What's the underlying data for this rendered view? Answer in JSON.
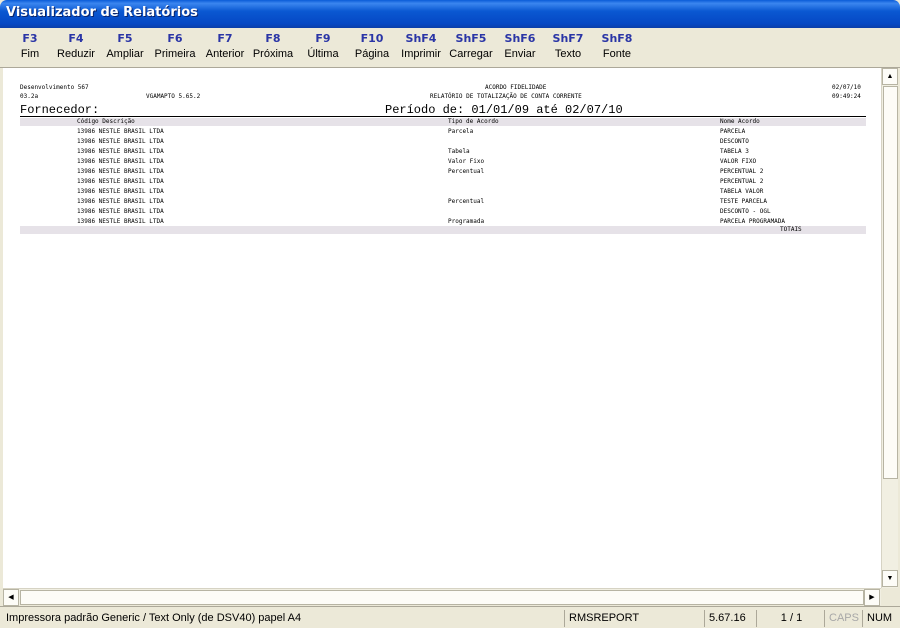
{
  "window": {
    "title": "Visualizador de Relatórios"
  },
  "toolbar": {
    "buttons": [
      {
        "key": "F3",
        "label": "Fim"
      },
      {
        "key": "F4",
        "label": "Reduzir"
      },
      {
        "key": "F5",
        "label": "Ampliar"
      },
      {
        "key": "F6",
        "label": "Primeira"
      },
      {
        "key": "F7",
        "label": "Anterior"
      },
      {
        "key": "F8",
        "label": "Próxima"
      },
      {
        "key": "F9",
        "label": "Última"
      },
      {
        "key": "F10",
        "label": "Página"
      },
      {
        "key": "ShF4",
        "label": "Imprimir"
      },
      {
        "key": "ShF5",
        "label": "Carregar"
      },
      {
        "key": "ShF6",
        "label": "Enviar"
      },
      {
        "key": "ShF7",
        "label": "Texto"
      },
      {
        "key": "ShF8",
        "label": "Fonte"
      }
    ]
  },
  "report": {
    "dept": "Desenvolvimento 567",
    "version": "03.2a",
    "program": "VGAMAPTO 5.65.2",
    "title": "ACORDO FIDELIDADE",
    "subtitle": "RELATÓRIO DE TOTALIZAÇÃO DE CONTA CORRENTE",
    "date": "02/07/10",
    "time": "09:49:24",
    "supplier_label": "Fornecedor:",
    "period": "Período de:  01/01/09  até  02/07/10",
    "col_code_desc": "Código Descrição",
    "col_type": "Tipo de Acordo",
    "col_name": "Nome Acordo",
    "rows": [
      {
        "code": "13986 NESTLE BRASIL LTDA",
        "type": "Parcela",
        "name": "PARCELA"
      },
      {
        "code": "13986 NESTLE BRASIL LTDA",
        "type": "",
        "name": "DESCONTO"
      },
      {
        "code": "13986 NESTLE BRASIL LTDA",
        "type": "Tabela",
        "name": "TABELA 3"
      },
      {
        "code": "13986 NESTLE BRASIL LTDA",
        "type": "Valor Fixo",
        "name": "VALOR FIXO"
      },
      {
        "code": "13986 NESTLE BRASIL LTDA",
        "type": "Percentual",
        "name": "PERCENTUAL 2"
      },
      {
        "code": "13986 NESTLE BRASIL LTDA",
        "type": "",
        "name": "PERCENTUAL 2"
      },
      {
        "code": "13986 NESTLE BRASIL LTDA",
        "type": "",
        "name": "TABELA VALOR"
      },
      {
        "code": "13986 NESTLE BRASIL LTDA",
        "type": "Percentual",
        "name": "TESTE PARCELA"
      },
      {
        "code": "13986 NESTLE BRASIL LTDA",
        "type": "",
        "name": "DESCONTO - OGL"
      },
      {
        "code": "13986 NESTLE BRASIL LTDA",
        "type": "Programada",
        "name": "PARCELA PROGRAMADA"
      }
    ],
    "totals_label": "TOTAIS"
  },
  "status": {
    "printer": "Impressora padrão Generic / Text Only (de DSV40) papel A4",
    "module": "RMSREPORT",
    "version": "5.67.16",
    "page": "1 / 1",
    "caps": "CAPS",
    "num": "NUM"
  },
  "scroll": {
    "up_arrow": "▲",
    "down_arrow": "▼",
    "left_arrow": "◀",
    "right_arrow": "▶"
  },
  "colors": {
    "title_bar": "#0548c4",
    "toolbar_key": "#2a35a6",
    "header_band": "#e6e2e8"
  }
}
